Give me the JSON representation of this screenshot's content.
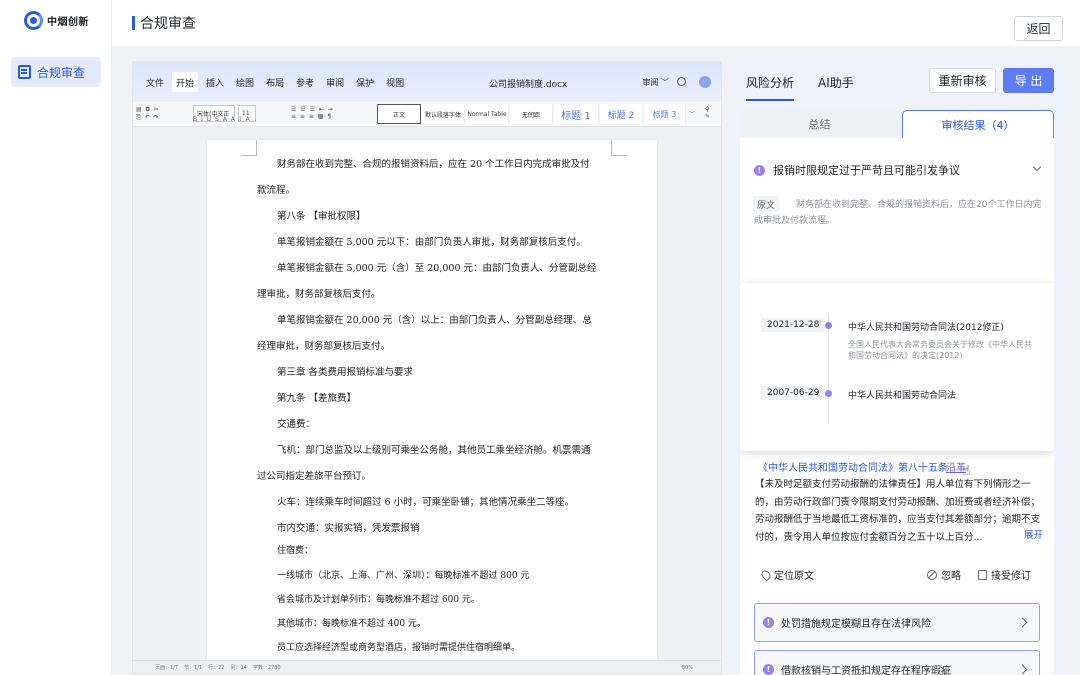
{
  "app": {
    "logo_text": "中烟创新"
  },
  "sidebar": {
    "items": [
      {
        "label": "合规审查"
      }
    ]
  },
  "header": {
    "title": "合规审查",
    "back_label": "返回"
  },
  "editor": {
    "menu": [
      "文件",
      "开始",
      "插入",
      "绘图",
      "布局",
      "参考",
      "审阅",
      "保护",
      "视图"
    ],
    "active_menu": "开始",
    "doc_name": "公司报销制度.docx",
    "review_mode": "审阅 ﹀",
    "toolbar": {
      "font_name": "宋体(中文正",
      "font_size": "11",
      "styles": [
        "正文",
        "默认段落字体",
        "Normal Table",
        "无间距",
        "标题 1",
        "标题 2",
        "标题 3"
      ]
    },
    "lines": [
      "财务部在收到完整、合规的报销资料后，应在 20 个工作日内完成审批及付",
      "款流程。",
      "第八条 【审批权限】",
      "单笔报销金额在 5,000 元以下：由部门负责人审批，财务部复核后支付。",
      "单笔报销金额在 5,000 元（含）至 20,000 元：由部门负责人、分管副总经",
      "理审批，财务部复核后支付。",
      "单笔报销金额在 20,000 元（含）以上：由部门负责人、分管副总经理、总",
      "经理审批，财务部复核后支付。",
      "第三章 各类费用报销标准与要求",
      "第九条 【差旅费】",
      "交通费：",
      "飞机：部门总监及以上级别可乘坐公务舱，其他员工乘坐经济舱。机票需通",
      "过公司指定差旅平台预订。",
      "火车：连续乘车时间超过 6 小时，可乘坐卧铺；其他情况乘坐二等座。",
      "市内交通：实报实销，凭发票报销",
      "住宿费：",
      "一线城市（北京、上海、广州、深圳）：每晚标准不超过 800 元",
      "省会城市及计划单列市：每晚标准不超过 600 元。",
      "其他城市：每晚标准不超过 400 元。",
      "员工应选择经济型或商务型酒店，报销时需提供住宿明细单。"
    ],
    "status": {
      "pages": "页面：1/7",
      "section": "节：1/1",
      "row": "行：22",
      "col": "列：14",
      "words": "字数：2730",
      "zoom": "80%"
    }
  },
  "panel": {
    "tabs": [
      "风险分析",
      "AI助手"
    ],
    "active_tab": "风险分析",
    "recheck_label": "重新审核",
    "export_label": "导 出",
    "segments": {
      "summary": "总结",
      "results": "审核结果（4）"
    },
    "issue": {
      "title": "报销时限规定过于严苛且可能引发争议",
      "orig_label": "原文",
      "orig_text": "财务部在收到完整、合规的报销资料后，应在20个工作日内完成审批及付款流程。",
      "timeline": [
        {
          "date": "2021-12-28",
          "title": "中华人民共和国劳动合同法(2012修正)",
          "sub": "全国人民代表大会常务委员会关于修改《中华人民共和国劳动合同法》的决定(2012)"
        },
        {
          "date": "2007-06-29",
          "title": "中华人民共和国劳动合同法",
          "sub": ""
        }
      ],
      "law_ref": "《中华人民共和国劳动合同法》第八十五条",
      "law_history": "沿革",
      "law_text": "【未及时足额支付劳动报酬的法律责任】用人单位有下列情形之一的，由劳动行政部门责令限期支付劳动报酬、加班费或者经济补偿；劳动报酬低于当地最低工资标准的，应当支付其差额部分；逾期不支付的，责令用人单位按应付金额百分之五十以上百分...",
      "expand_label": "展开",
      "actions": {
        "locate": "定位原文",
        "ignore": "忽略",
        "accept": "接受修订"
      }
    },
    "other_issues": [
      {
        "title": "处罚措施规定模糊且存在法律风险"
      },
      {
        "title": "借款核销与工资抵扣规定存在程序瑕疵"
      }
    ]
  }
}
